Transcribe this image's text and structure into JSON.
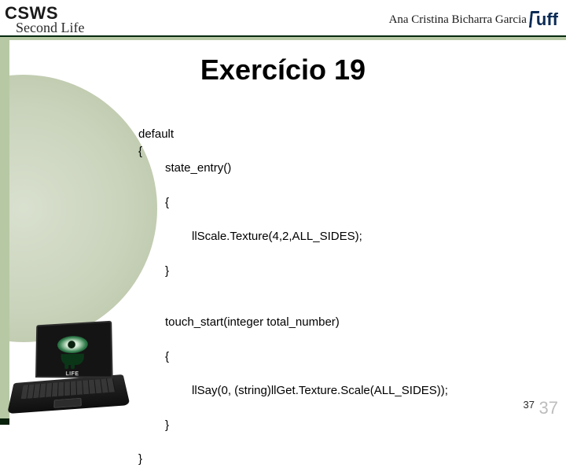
{
  "header": {
    "logo_top": "CSWS",
    "logo_sub": "Second Life",
    "author": "Ana Cristina Bicharra Garcia",
    "uff": "uff"
  },
  "title": "Exercício 19",
  "code": {
    "l1": "default",
    "l2": "{",
    "l3": "state_entry()",
    "l4": "{",
    "l5": "llScale.Texture(4,2,ALL_SIDES);",
    "l6": "}",
    "l7": "touch_start(integer total_number)",
    "l8": "{",
    "l9": "llSay(0, (string)llGet.Texture.Scale(ALL_SIDES));",
    "l10": "}",
    "l11": "}"
  },
  "laptop": {
    "badge_text": "LIFE"
  },
  "page_number": "37",
  "page_number_shadow": "37"
}
